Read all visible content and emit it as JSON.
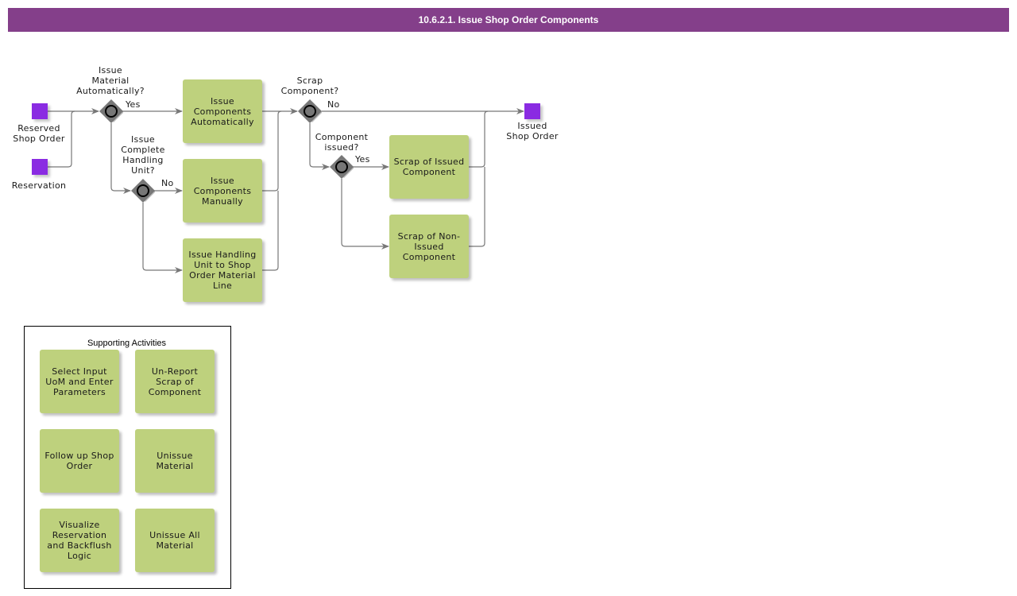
{
  "title": "10.6.2.1. Issue Shop Order Components",
  "colors": {
    "title_bar": "#843f8a",
    "event": "#8a2be2",
    "task": "#bed17d",
    "gateway": "#777777",
    "connector": "#777777"
  },
  "events": {
    "reserved_shop_order": "Reserved\nShop Order",
    "reservation": "Reservation",
    "issued_shop_order": "Issued\nShop Order"
  },
  "gateways": {
    "issue_material_automatically": "Issue\nMaterial\nAutomatically?",
    "issue_complete_handling_unit": "Issue\nComplete\nHandling\nUnit?",
    "scrap_component": "Scrap\nComponent?",
    "component_issued": "Component\nissued?"
  },
  "flow_labels": {
    "auto_yes": "Yes",
    "hu_no": "No",
    "scrap_no": "No",
    "issued_yes": "Yes"
  },
  "tasks": {
    "issue_components_automatically": "Issue Components Automatically",
    "issue_components_manually": "Issue Components Manually",
    "issue_handling_unit": "Issue Handling Unit to Shop Order Material Line",
    "scrap_issued": "Scrap of Issued Component",
    "scrap_non_issued": "Scrap of Non-Issued Component"
  },
  "supporting": {
    "title": "Supporting Activities",
    "items": [
      "Select Input UoM and Enter Parameters",
      "Un-Report Scrap of Component",
      "Follow up Shop Order",
      "Unissue Material",
      "Visualize Reservation and Backflush Logic",
      "Unissue All Material"
    ]
  }
}
